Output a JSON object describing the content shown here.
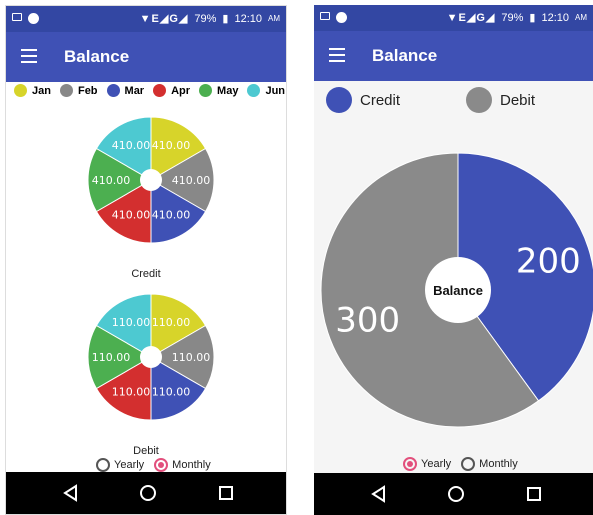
{
  "status": {
    "battery": "79%",
    "time": "12:10",
    "ampm": "AM",
    "glyphs": "▼E◢G◢"
  },
  "left": {
    "title": "Balance",
    "legend": [
      {
        "label": "Jan",
        "color": "#d7d42a"
      },
      {
        "label": "Feb",
        "color": "#888888"
      },
      {
        "label": "Mar",
        "color": "#3f51b5"
      },
      {
        "label": "Apr",
        "color": "#d32f2f"
      },
      {
        "label": "May",
        "color": "#4caf50"
      },
      {
        "label": "Jun",
        "color": "#4dc9d1"
      }
    ],
    "credit_label": "Credit",
    "debit_label": "Debit",
    "radio_yearly": "Yearly",
    "radio_monthly": "Monthly",
    "selected": "Monthly"
  },
  "right": {
    "title": "Balance",
    "legend_credit": "Credit",
    "legend_debit": "Debit",
    "center_label": "Balance",
    "radio_yearly": "Yearly",
    "radio_monthly": "Monthly",
    "selected": "Yearly"
  },
  "chart_data": [
    {
      "type": "pie",
      "title": "Credit",
      "categories": [
        "Jan",
        "Feb",
        "Mar",
        "Apr",
        "May",
        "Jun"
      ],
      "values": [
        410.0,
        410.0,
        410.0,
        410.0,
        410.0,
        410.0
      ],
      "labels": [
        "410.00",
        "410.00",
        "410.00",
        "410.00",
        "410.00",
        "410.00"
      ],
      "colors": [
        "#d7d42a",
        "#888888",
        "#3f51b5",
        "#d32f2f",
        "#4caf50",
        "#4dc9d1"
      ]
    },
    {
      "type": "pie",
      "title": "Debit",
      "categories": [
        "Jan",
        "Feb",
        "Mar",
        "Apr",
        "May",
        "Jun"
      ],
      "values": [
        110.0,
        110.0,
        110.0,
        110.0,
        110.0,
        110.0
      ],
      "labels": [
        "110.00",
        "110.00",
        "110.00",
        "110.00",
        "110.00",
        "110.00"
      ],
      "colors": [
        "#d7d42a",
        "#888888",
        "#3f51b5",
        "#d32f2f",
        "#4caf50",
        "#4dc9d1"
      ]
    },
    {
      "type": "pie",
      "title": "",
      "categories": [
        "Credit",
        "Debit"
      ],
      "values": [
        200,
        300
      ],
      "labels": [
        "200",
        "300"
      ],
      "colors": [
        "#3f51b5",
        "#8a8a8a"
      ]
    }
  ]
}
